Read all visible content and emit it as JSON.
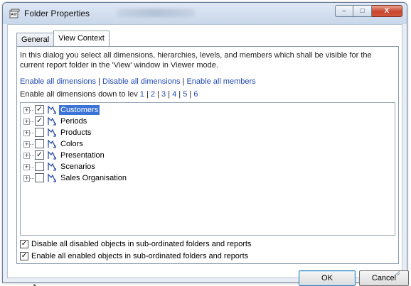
{
  "window": {
    "title": "Folder Properties",
    "buttons": {
      "minimize": "–",
      "maximize": "□",
      "close": "X"
    }
  },
  "tabs": [
    {
      "label": "General",
      "active": false
    },
    {
      "label": "View Context",
      "active": true
    }
  ],
  "intro_text": "In this dialog you select all dimensions, hierarchies, levels, and members which shall be visible for the current report folder in the 'View' window in Viewer mode.",
  "links": {
    "enable_all_dimensions": "Enable all dimensions",
    "disable_all_dimensions": "Disable all dimensions",
    "enable_all_members": "Enable all members",
    "separator": "|"
  },
  "levels": {
    "prefix": "Enable all dimensions down to lev",
    "items": [
      "1",
      "2",
      "3",
      "4",
      "5",
      "6"
    ]
  },
  "tree": [
    {
      "label": "Customers",
      "checked": true,
      "selected": true
    },
    {
      "label": "Periods",
      "checked": true,
      "selected": false
    },
    {
      "label": "Products",
      "checked": false,
      "selected": false
    },
    {
      "label": "Colors",
      "checked": false,
      "selected": false
    },
    {
      "label": "Presentation",
      "checked": true,
      "selected": false
    },
    {
      "label": "Scenarios",
      "checked": false,
      "selected": false
    },
    {
      "label": "Sales Organisation",
      "checked": false,
      "selected": false
    }
  ],
  "options": {
    "disable_label": "Disable all disabled objects in sub-ordinated folders and reports",
    "disable_checked": true,
    "enable_label": "Enable all enabled objects in sub-ordinated folders and reports",
    "enable_checked": true
  },
  "buttons": {
    "ok": "OK",
    "cancel": "Cancel"
  },
  "colors": {
    "link": "#2249b6",
    "selection": "#3b74d6",
    "hierarchy_icon": "#2a4fa8",
    "close_button": "#c7452c"
  }
}
